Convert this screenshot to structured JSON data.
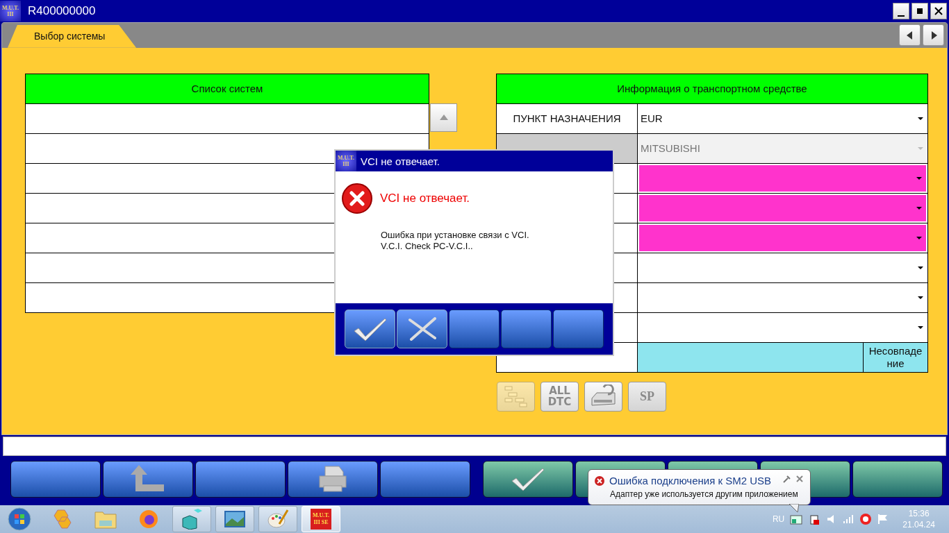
{
  "window": {
    "logo": [
      "M.U.T.",
      "III"
    ],
    "title": "R400000000"
  },
  "tabs": [
    {
      "label": "Выбор системы",
      "selected": true
    }
  ],
  "system_list": {
    "header": "Список систем"
  },
  "vehicle_info": {
    "header": "Информация о транспортном средстве",
    "rows": [
      {
        "kind": "select",
        "label": "ПУНКТ НАЗНАЧЕНИЯ",
        "value": "EUR",
        "disabled": false,
        "highlighted": false
      },
      {
        "kind": "select",
        "value": "MITSUBISHI",
        "disabled": true,
        "highlighted": false
      },
      {
        "kind": "select",
        "disabled": false,
        "highlighted": true
      },
      {
        "kind": "select",
        "disabled": false,
        "highlighted": true
      },
      {
        "kind": "select",
        "disabled": false,
        "highlighted": true
      },
      {
        "kind": "select",
        "disabled": false,
        "highlighted": false
      },
      {
        "kind": "select",
        "disabled": false,
        "highlighted": false
      },
      {
        "kind": "select",
        "disabled": false,
        "highlighted": false
      },
      {
        "kind": "vin",
        "status": "Несовпаде ние"
      }
    ]
  },
  "tool_buttons": [
    {
      "kind": "tree",
      "disabled": true
    },
    {
      "kind": "all_dtc",
      "lines": [
        "ALL",
        "DTC"
      ],
      "disabled": true
    },
    {
      "kind": "ecu",
      "disabled": false
    },
    {
      "kind": "sp",
      "label": "SP",
      "disabled": true
    }
  ],
  "dialog": {
    "logo": [
      "M.U.T.",
      "III"
    ],
    "title": "VCI не отвечает.",
    "heading": "VCI не отвечает.",
    "message": [
      "Ошибка при установке связи с VCI.",
      "V.C.I. Check PC-V.C.I.."
    ],
    "buttons": [
      {
        "kind": "ok"
      },
      {
        "kind": "cancel"
      },
      {
        "kind": "blank"
      },
      {
        "kind": "blank"
      },
      {
        "kind": "blank"
      }
    ]
  },
  "bottom_bar": {
    "left": [
      {
        "kind": "blank"
      },
      {
        "kind": "back"
      },
      {
        "kind": "blank"
      },
      {
        "kind": "print"
      },
      {
        "kind": "blank"
      }
    ],
    "right": [
      {
        "kind": "ok"
      },
      {
        "kind": "blank"
      },
      {
        "kind": "blank"
      },
      {
        "kind": "blank"
      },
      {
        "kind": "blank"
      }
    ]
  },
  "notification": {
    "title": "Ошибка подключения к SM2 USB",
    "message": "Адаптер уже используется другим приложением"
  },
  "taskbar": {
    "pinned": [
      {
        "kind": "tools"
      },
      {
        "kind": "folder"
      },
      {
        "kind": "browser"
      }
    ],
    "items": [
      {
        "kind": "registry",
        "selected": false
      },
      {
        "kind": "viewer",
        "selected": false
      },
      {
        "kind": "paint",
        "selected": false
      },
      {
        "kind": "mut",
        "lines": [
          "M.U.T.",
          "III SE"
        ],
        "selected": true
      }
    ],
    "language": "RU",
    "time": "15:36",
    "date": "21.04.24"
  }
}
